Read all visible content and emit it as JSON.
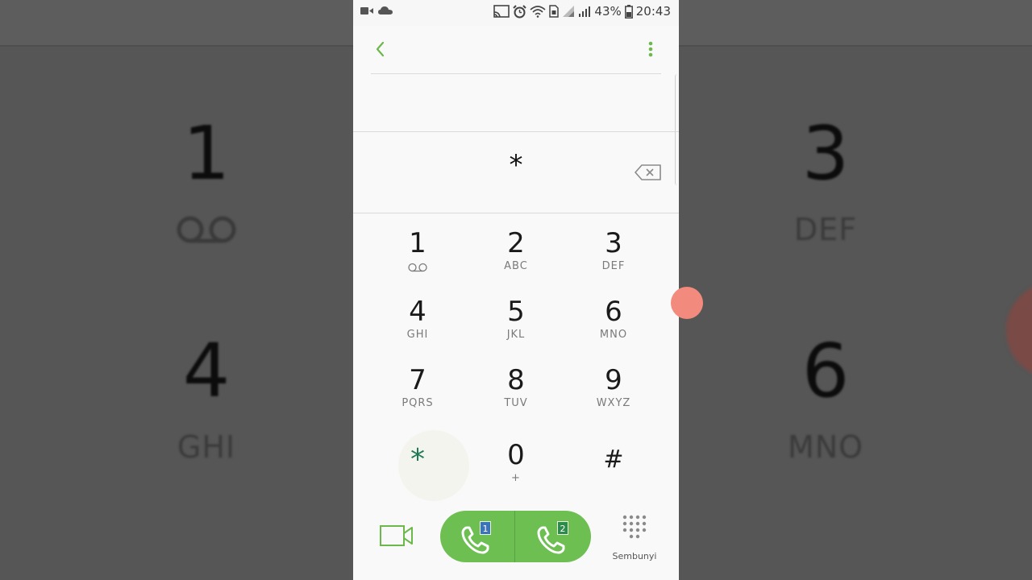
{
  "status_bar": {
    "battery_percent": "43%",
    "time": "20:43"
  },
  "dialer": {
    "entered_number": "*",
    "keys": [
      {
        "digit": "1",
        "letters": ""
      },
      {
        "digit": "2",
        "letters": "ABC"
      },
      {
        "digit": "3",
        "letters": "DEF"
      },
      {
        "digit": "4",
        "letters": "GHI"
      },
      {
        "digit": "5",
        "letters": "JKL"
      },
      {
        "digit": "6",
        "letters": "MNO"
      },
      {
        "digit": "7",
        "letters": "PQRS"
      },
      {
        "digit": "8",
        "letters": "TUV"
      },
      {
        "digit": "9",
        "letters": "WXYZ"
      },
      {
        "digit": "*",
        "letters": ""
      },
      {
        "digit": "0",
        "letters": "+"
      },
      {
        "digit": "#",
        "letters": ""
      }
    ]
  },
  "bottom": {
    "sim1_badge": "1",
    "sim2_badge": "2",
    "hide_label": "Sembunyi"
  },
  "background": {
    "keys": [
      {
        "digit": "1",
        "letters": ""
      },
      {
        "digit": "3",
        "letters": "DEF"
      },
      {
        "digit": "4",
        "letters": "GHI"
      },
      {
        "digit": "6",
        "letters": "MNO"
      }
    ]
  },
  "colors": {
    "accent_green": "#6dbf52",
    "star_green": "#1e7a55",
    "sim1_blue": "#3d73b8",
    "sim2_green": "#2c8a4a"
  }
}
